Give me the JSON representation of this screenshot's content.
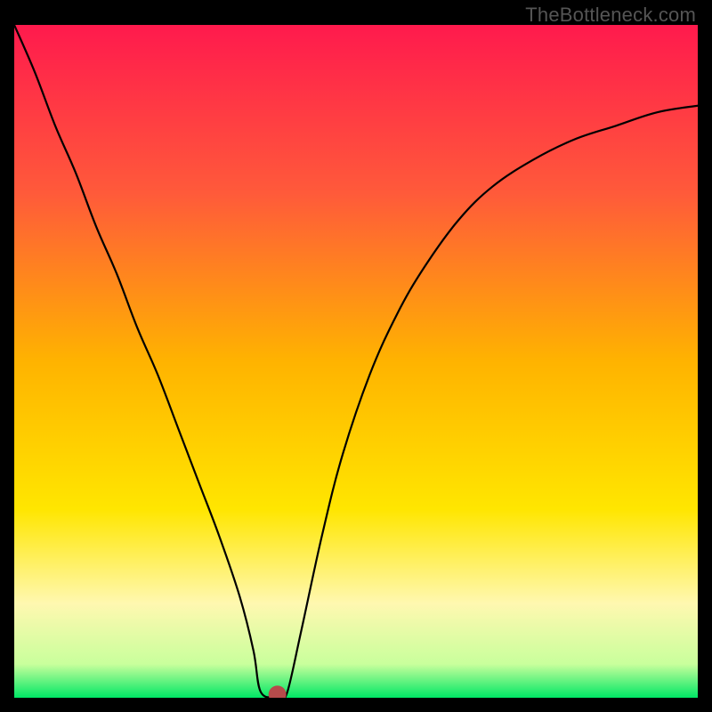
{
  "watermark": "TheBottleneck.com",
  "chart_data": {
    "type": "line",
    "title": "",
    "xlabel": "",
    "ylabel": "",
    "xlim": [
      0,
      100
    ],
    "ylim": [
      0,
      100
    ],
    "grid": false,
    "legend": false,
    "background_gradient_stops": [
      {
        "offset": 0,
        "color": "#ff1a4d"
      },
      {
        "offset": 25,
        "color": "#ff5a3a"
      },
      {
        "offset": 50,
        "color": "#ffb300"
      },
      {
        "offset": 72,
        "color": "#ffe600"
      },
      {
        "offset": 86,
        "color": "#fff8b0"
      },
      {
        "offset": 95,
        "color": "#c9ff9c"
      },
      {
        "offset": 100,
        "color": "#00e765"
      }
    ],
    "series": [
      {
        "name": "bottleneck-curve",
        "x": [
          0,
          3,
          6,
          9,
          12,
          15,
          18,
          21,
          24,
          27,
          30,
          33,
          35,
          36,
          38,
          39,
          40,
          42,
          45,
          48,
          52,
          56,
          60,
          65,
          70,
          76,
          82,
          88,
          94,
          100
        ],
        "y": [
          100,
          93,
          85,
          78,
          70,
          63,
          55,
          48,
          40,
          32,
          24,
          15,
          7,
          1,
          0,
          0,
          1,
          10,
          24,
          36,
          48,
          57,
          64,
          71,
          76,
          80,
          83,
          85,
          87,
          88
        ]
      }
    ],
    "marker": {
      "x": 38.5,
      "y": 0.5,
      "color": "#b64b4b",
      "r": 1.3
    }
  }
}
